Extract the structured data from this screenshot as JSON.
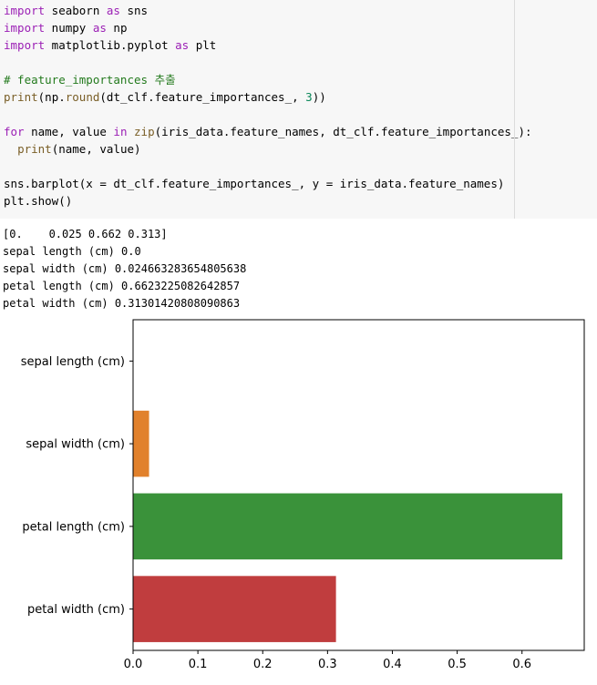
{
  "code_cell": {
    "lines": [
      [
        {
          "t": "import",
          "c": "kw"
        },
        {
          "t": " seaborn "
        },
        {
          "t": "as",
          "c": "kw"
        },
        {
          "t": " sns"
        }
      ],
      [
        {
          "t": "import",
          "c": "kw"
        },
        {
          "t": " numpy "
        },
        {
          "t": "as",
          "c": "kw"
        },
        {
          "t": " np"
        }
      ],
      [
        {
          "t": "import",
          "c": "kw"
        },
        {
          "t": " matplotlib.pyplot "
        },
        {
          "t": "as",
          "c": "kw"
        },
        {
          "t": " plt"
        }
      ],
      [],
      [
        {
          "t": "# feature_importances 추출",
          "c": "cm"
        }
      ],
      [
        {
          "t": "print",
          "c": "fn"
        },
        {
          "t": "(np."
        },
        {
          "t": "round",
          "c": "fn"
        },
        {
          "t": "(dt_clf.feature_importances_, "
        },
        {
          "t": "3",
          "c": "num"
        },
        {
          "t": "))"
        }
      ],
      [],
      [
        {
          "t": "for",
          "c": "kw"
        },
        {
          "t": " name, value "
        },
        {
          "t": "in",
          "c": "kw"
        },
        {
          "t": " "
        },
        {
          "t": "zip",
          "c": "fn"
        },
        {
          "t": "(iris_data.feature_names, dt_clf.feature_importances_):"
        }
      ],
      [
        {
          "t": "  "
        },
        {
          "t": "print",
          "c": "fn"
        },
        {
          "t": "(name, value)"
        }
      ],
      [],
      [
        {
          "t": "sns.barplot(x = dt_clf.feature_importances_, y = iris_data.feature_names)"
        }
      ],
      [
        {
          "t": "plt.show()"
        }
      ]
    ]
  },
  "output": {
    "lines": [
      "[0.    0.025 0.662 0.313]",
      "sepal length (cm) 0.0",
      "sepal width (cm) 0.024663283654805638",
      "petal length (cm) 0.6623225082642857",
      "petal width (cm) 0.31301420808090863"
    ]
  },
  "chart_data": {
    "type": "bar",
    "orientation": "horizontal",
    "categories": [
      "sepal length (cm)",
      "sepal width (cm)",
      "petal length (cm)",
      "petal width (cm)"
    ],
    "values": [
      0.0,
      0.024663283654805638,
      0.6623225082642857,
      0.31301420808090863
    ],
    "colors": [
      "#3274a1",
      "#e1812c",
      "#3a923a",
      "#c03d3e"
    ],
    "xticks": [
      0.0,
      0.1,
      0.2,
      0.3,
      0.4,
      0.5,
      0.6
    ],
    "xtick_labels": [
      "0.0",
      "0.1",
      "0.2",
      "0.3",
      "0.4",
      "0.5",
      "0.6"
    ],
    "xlim": [
      0,
      0.696
    ],
    "title": "",
    "xlabel": "",
    "ylabel": "",
    "grid": false
  }
}
